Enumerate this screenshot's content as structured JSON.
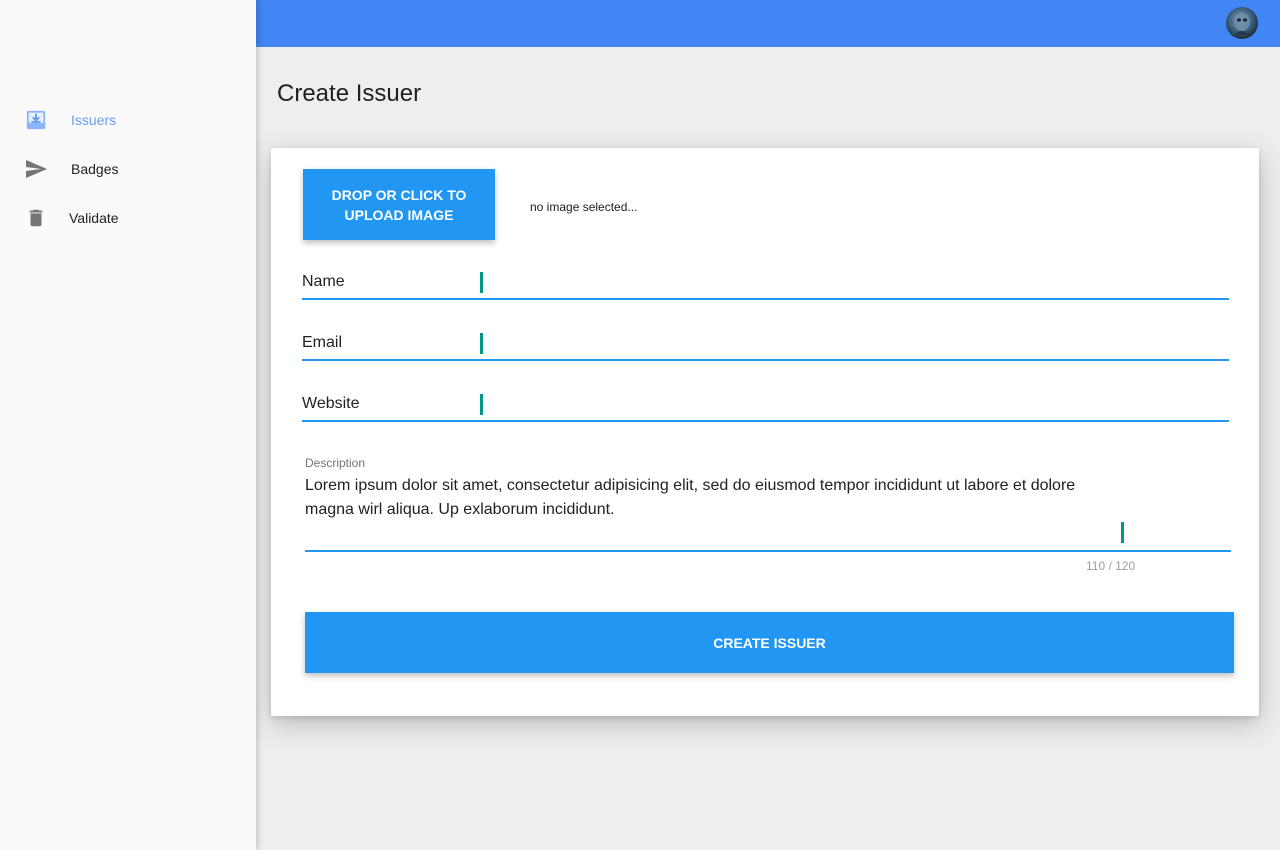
{
  "sidebar": {
    "items": [
      {
        "label": "Issuers",
        "icon": "inbox-download-icon",
        "active": true
      },
      {
        "label": "Badges",
        "icon": "send-icon",
        "active": false
      },
      {
        "label": "Validate",
        "icon": "trash-icon",
        "active": false
      }
    ]
  },
  "topbar": {
    "avatar": "user-avatar"
  },
  "page": {
    "title": "Create Issuer"
  },
  "form": {
    "upload_button": "DROP OR CLICK TO UPLOAD IMAGE",
    "upload_status": "no image selected...",
    "fields": [
      {
        "label": "Name",
        "value": ""
      },
      {
        "label": "Email",
        "value": ""
      },
      {
        "label": "Website",
        "value": ""
      }
    ],
    "description": {
      "label": "Description",
      "value": "Lorem ipsum dolor sit amet, consectetur adipisicing elit, sed do eiusmod tempor incididunt ut labore et dolore magna wirl aliqua. Up exlaborum incididunt.",
      "counter": "110 / 120"
    },
    "submit_label": "CREATE ISSUER"
  },
  "colors": {
    "primary": "#2196f3",
    "topbar": "#4285f4",
    "active_nav": "#6b9cf0",
    "caret": "#009688",
    "icon_gray": "#757575"
  }
}
